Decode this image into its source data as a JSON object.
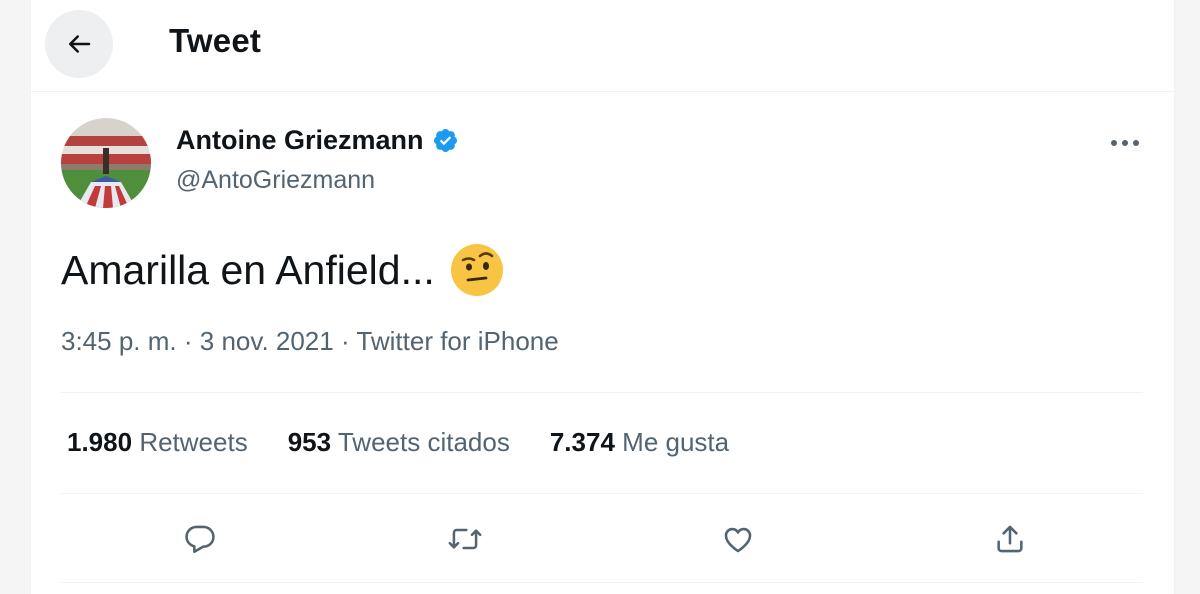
{
  "header": {
    "title": "Tweet"
  },
  "author": {
    "name": "Antoine Griezmann",
    "handle": "@AntoGriezmann",
    "verified": true
  },
  "tweet": {
    "text": "Amarilla en Anfield...",
    "emoji": "face-with-raised-eyebrow",
    "time": "3:45 p. m.",
    "date": "3 nov. 2021",
    "source": "Twitter for iPhone",
    "separator": "·"
  },
  "stats": {
    "retweets_count": "1.980",
    "retweets_label": "Retweets",
    "quotes_count": "953",
    "quotes_label": "Tweets citados",
    "likes_count": "7.374",
    "likes_label": "Me gusta"
  },
  "actions": [
    "reply-icon",
    "retweet-icon",
    "like-icon",
    "share-icon"
  ],
  "colors": {
    "verified": "#1d9bf0",
    "secondary_text": "#536471",
    "divider": "#eff3f4"
  }
}
